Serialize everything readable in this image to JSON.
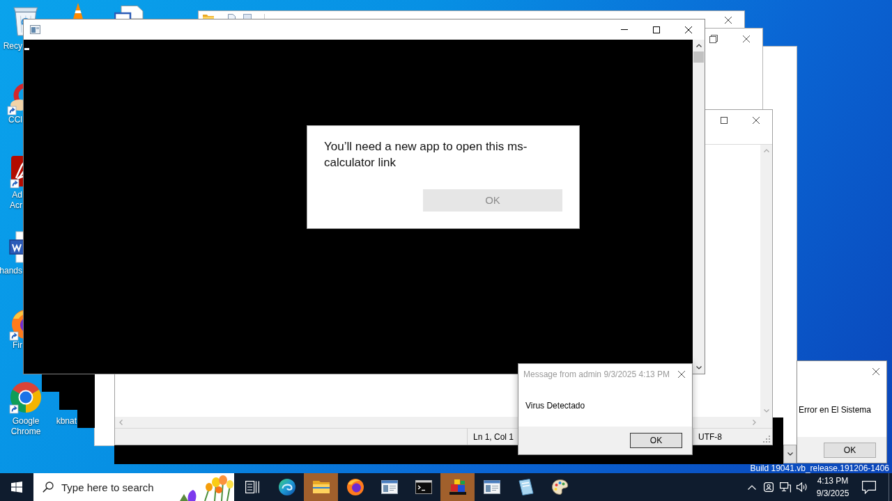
{
  "desktop_icons": [
    {
      "kind": "recycle-bin",
      "label": [
        "Recy"
      ]
    },
    {
      "kind": "cleaner",
      "label": [
        "CCl"
      ]
    },
    {
      "kind": "pdf",
      "label": [
        "Ad",
        "Acr"
      ]
    },
    {
      "kind": "document",
      "label": [
        "hands"
      ]
    },
    {
      "kind": "firefox",
      "label": [
        "Fir"
      ]
    },
    {
      "kind": "chrome",
      "label": [
        "Google",
        "Chrome"
      ]
    },
    {
      "kind": "covered",
      "label": [
        "kbnat"
      ]
    }
  ],
  "app_prompt": {
    "message": "You’ll need a new app to open this ms-calculator link",
    "button": {
      "label": "OK",
      "disabled": true
    }
  },
  "notepad": {
    "status_bar": {
      "position": "Ln 1, Col 1",
      "encoding": "UTF-8"
    }
  },
  "message_box": {
    "title": "Message from admin 9/3/2025 4:13 PM",
    "text": "Virus Detectado",
    "button": "OK"
  },
  "error_box": {
    "text": "Error en El Sistema",
    "button": "OK"
  },
  "build_info": "Build 19041.vb_release.191206-1406",
  "taskbar": {
    "search": {
      "placeholder": "Type here to search"
    },
    "apps": [
      {
        "kind": "task-view",
        "flashing": false
      },
      {
        "kind": "edge",
        "flashing": false
      },
      {
        "kind": "folder",
        "flashing": true
      },
      {
        "kind": "firefox",
        "flashing": false
      },
      {
        "kind": "window",
        "flashing": false
      },
      {
        "kind": "terminal",
        "flashing": false
      },
      {
        "kind": "blocks",
        "flashing": true
      },
      {
        "kind": "window",
        "flashing": false
      },
      {
        "kind": "notepad",
        "flashing": false
      },
      {
        "kind": "paint",
        "flashing": false
      }
    ],
    "clock": {
      "time": "4:13 PM",
      "date": "9/3/2025"
    }
  }
}
